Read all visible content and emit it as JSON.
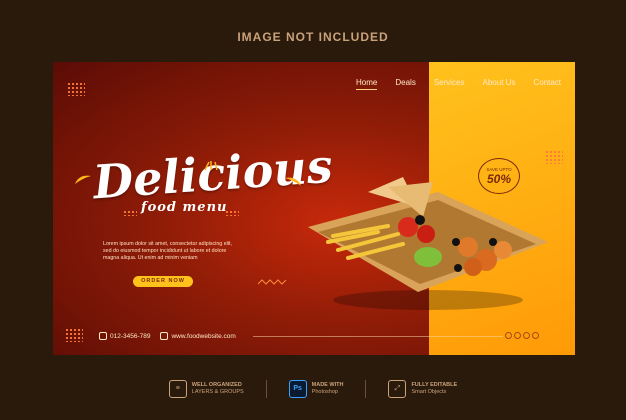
{
  "top_note": "IMAGE NOT INCLUDED",
  "nav": {
    "items": [
      {
        "label": "Home"
      },
      {
        "label": "Deals"
      },
      {
        "label": "Services"
      },
      {
        "label": "About Us"
      },
      {
        "label": "Contact"
      }
    ]
  },
  "hero": {
    "headline": "Delicious",
    "sub_headline": "food menu",
    "body": "Lorem ipsum dolor sit amet, consectetur adipiscing elit, sed do eiusmod tempor incididunt ut labore et dolore magna aliqua. Ut enim ad minim veniam",
    "order_button": "ORDER NOW"
  },
  "badge": {
    "small": "SAVE UPTO",
    "big": "50%"
  },
  "footer": {
    "phone": "012-3456-789",
    "website": "www.foodwebsite.com"
  },
  "features": [
    {
      "title": "WELL ORGANIZED",
      "subtitle": "LAYERS & GROUPS",
      "icon": "layers-icon",
      "glyph": "≡"
    },
    {
      "title": "MADE WITH",
      "subtitle": "Photoshop",
      "icon": "photoshop-icon",
      "glyph": "Ps"
    },
    {
      "title": "FULLY EDITABLE",
      "subtitle": "Smart Objects",
      "icon": "smart-object-icon",
      "glyph": "⤢"
    }
  ],
  "colors": {
    "accent": "#ffc21d",
    "banner_dark": "#8e1c07"
  }
}
